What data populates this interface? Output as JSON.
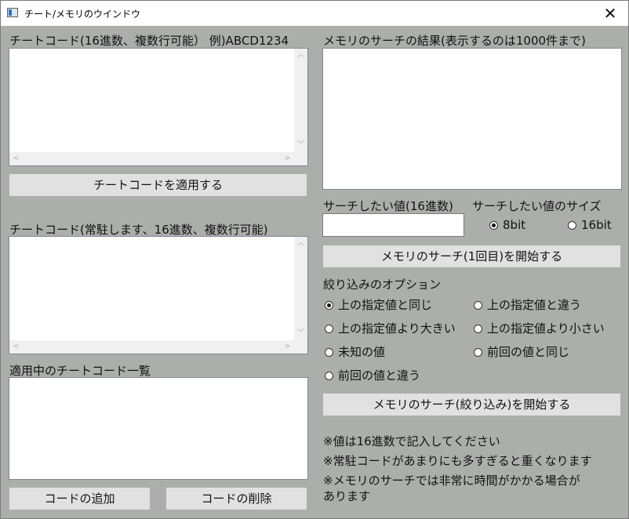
{
  "window": {
    "title": "チート/メモリのウインドウ",
    "close": "✕"
  },
  "left": {
    "cheat_code_label": "チートコード(16進数、複数行可能） 例)ABCD1234",
    "cheat_code_value": "",
    "apply_button": "チートコードを適用する",
    "resident_label": "チートコード(常駐します、16進数、複数行可能)",
    "resident_value": "",
    "active_list_label": "適用中のチートコード一覧",
    "active_list_items": [],
    "add_button": "コードの追加",
    "delete_button": "コードの削除"
  },
  "right": {
    "results_label": "メモリのサーチの結果(表示するのは1000件まで)",
    "results_items": [],
    "search_value_label": "サーチしたい値(16進数)",
    "search_value": "",
    "size_label": "サーチしたい値のサイズ",
    "size_options": [
      "8bit",
      "16bit"
    ],
    "size_selected": "8bit",
    "first_search_button": "メモリのサーチ(1回目)を開始する",
    "filter_label": "絞り込みのオプション",
    "filter_options": [
      "上の指定値と同じ",
      "上の指定値と違う",
      "上の指定値より大きい",
      "上の指定値より小さい",
      "未知の値",
      "前回の値と同じ",
      "前回の値と違う"
    ],
    "filter_selected": "上の指定値と同じ",
    "narrow_search_button": "メモリのサーチ(絞り込み)を開始する",
    "notes": [
      "※値は16進数で記入してください",
      "※常駐コードがあまりにも多すぎると重くなります",
      "※メモリのサーチでは非常に時間がかかる場合が",
      "あります"
    ]
  }
}
